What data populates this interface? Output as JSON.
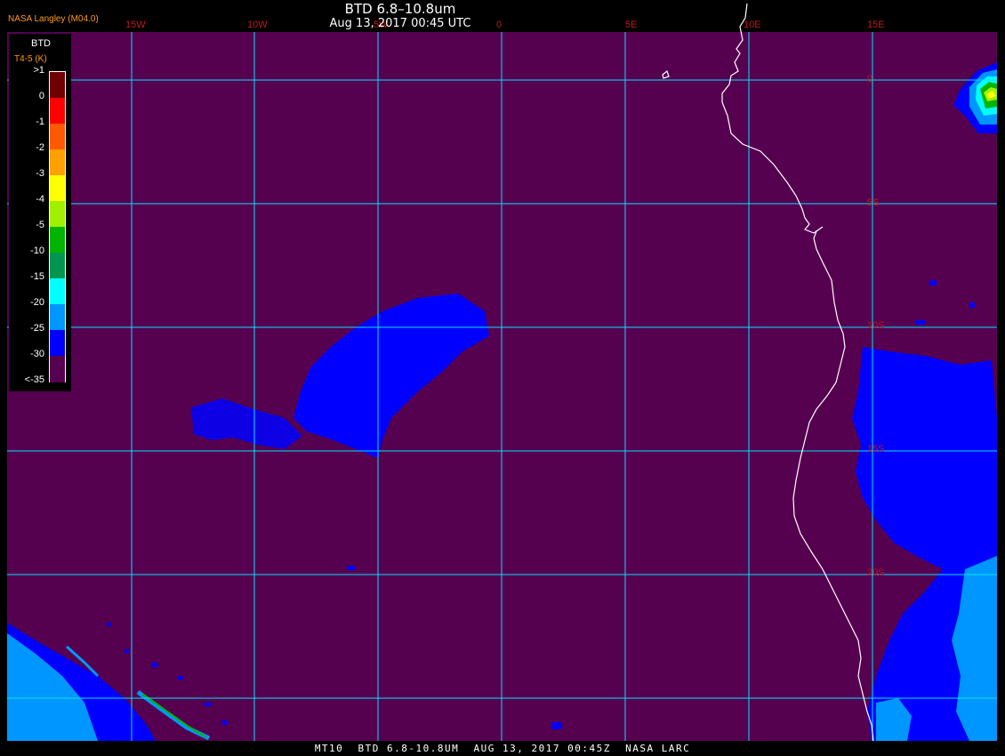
{
  "header": {
    "title": "BTD 6.8–10.8um",
    "datetime": "Aug 13, 2017 00:45 UTC",
    "producer": "NASA Langley (M04.0)"
  },
  "legend": {
    "title": "BTD",
    "subtitle": "T4-5 (K)",
    "ticks": [
      ">1",
      "0",
      "-1",
      "-2",
      "-3",
      "-4",
      "-5",
      "-10",
      "-15",
      "-20",
      "-25",
      "-30",
      "<-35"
    ],
    "colors": [
      "#6e0000",
      "#ff0000",
      "#ff5a00",
      "#ffa000",
      "#ffff00",
      "#a0f000",
      "#00b400",
      "#009650",
      "#00ffff",
      "#0096ff",
      "#0000ff",
      "#560050"
    ]
  },
  "grid": {
    "lon_labels": [
      "15W",
      "10W",
      "5W",
      "0",
      "5E",
      "10E",
      "15E"
    ],
    "lat_labels": [
      "0",
      "5S",
      "10S",
      "15S",
      "20S"
    ],
    "color": "#00e5ff"
  },
  "colors": {
    "background": "#560050",
    "grid": "#00e5ff",
    "coast": "#ffffff",
    "label": "#c01818",
    "cloud_core": "#0000ff",
    "cloud_light": "#0096ff"
  },
  "footer": {
    "text": "MT10  BTD 6.8-10.8UM  AUG 13, 2017 00:45Z  NASA LARC"
  }
}
